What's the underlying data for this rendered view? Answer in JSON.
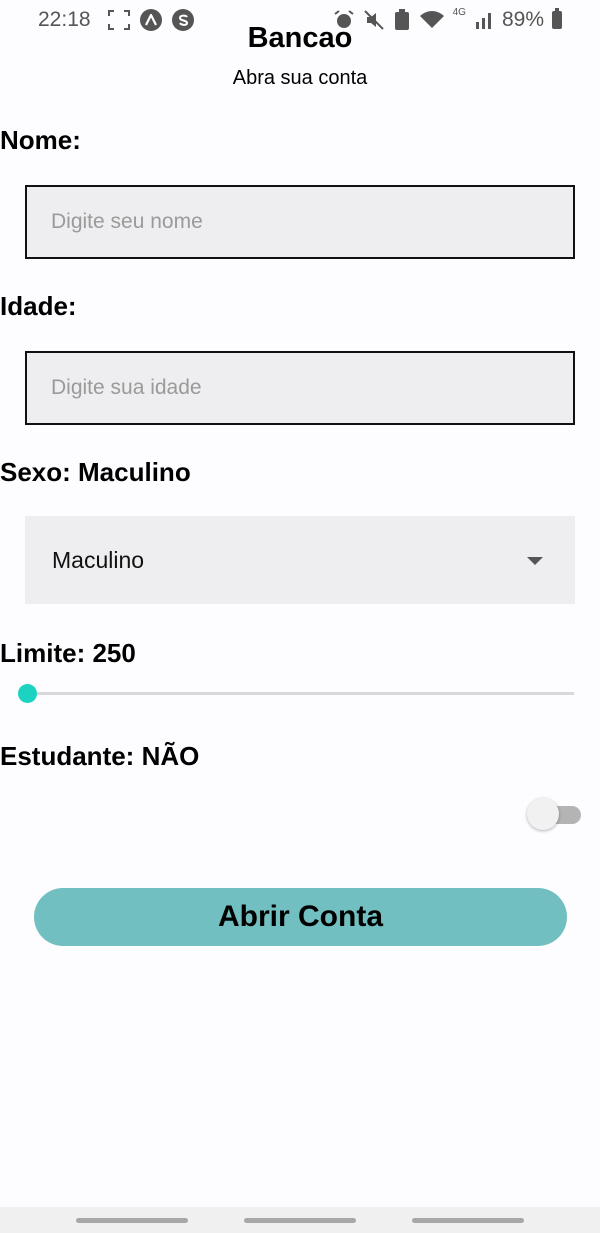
{
  "status_bar": {
    "time": "22:18",
    "battery": "89%",
    "network": "4G",
    "left_icons": [
      "screenshot-icon",
      "app-icon-a",
      "app-icon-s"
    ],
    "right_icons": [
      "alarm-icon",
      "mute-icon",
      "battery-saver-icon",
      "wifi-icon",
      "signal-icon",
      "battery-icon"
    ]
  },
  "header": {
    "title": "Bancao",
    "subtitle": "Abra sua conta"
  },
  "form": {
    "name": {
      "label": "Nome:",
      "value": "",
      "placeholder": "Digite seu nome"
    },
    "age": {
      "label": "Idade:",
      "value": "",
      "placeholder": "Digite sua idade"
    },
    "sex": {
      "label": "Sexo: Maculino",
      "selected": "Maculino"
    },
    "limit": {
      "label": "Limite: 250",
      "value": 250,
      "fraction": 0.0
    },
    "student": {
      "label": "Estudante: NÃO",
      "on": false
    },
    "submit_label": "Abrir Conta"
  },
  "colors": {
    "accent": "#1cd3c1",
    "button": "#72bfc1",
    "background": "#fdfcfe",
    "input_background": "#eeedef"
  }
}
